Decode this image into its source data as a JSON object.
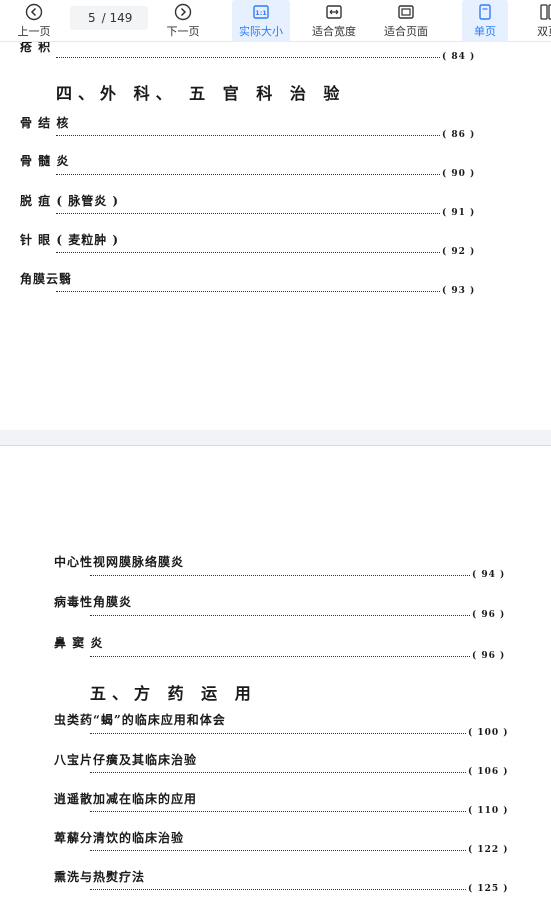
{
  "toolbar": {
    "prev_label": "上一页",
    "page_current": "5",
    "page_total": "/ 149",
    "next_label": "下一页",
    "actual_size_label": "实际大小",
    "fit_width_label": "适合宽度",
    "fit_page_label": "适合页面",
    "single_page_label": "单页",
    "double_page_label": "双页"
  },
  "page1": {
    "partial_top": "疮  积",
    "partial_top_page": "( 84 )",
    "heading": "四、外 科、 五 官 科 治 验",
    "entries": [
      {
        "title": "骨  结  核",
        "page": "( 86 )"
      },
      {
        "title": "骨  髓  炎",
        "page": "( 90 )"
      },
      {
        "title": "脱     疽 ( 脉管炎 )",
        "page": "( 91 )"
      },
      {
        "title": "针     眼 ( 麦粒肿 )",
        "page": "( 92 )"
      },
      {
        "title": "角膜云翳",
        "page": "( 93 )"
      }
    ]
  },
  "page2": {
    "entries_a": [
      {
        "title": "中心性视网膜脉络膜炎",
        "page": "( 94 )"
      },
      {
        "title": "病毒性角膜炎",
        "page": "( 96 )"
      },
      {
        "title": "鼻  窦  炎",
        "page": "( 96 )"
      }
    ],
    "heading": "五、方  药  运  用",
    "entries_b": [
      {
        "title": "虫类药“蝎”的临床应用和体会",
        "page": "( 100 )"
      },
      {
        "title": "八宝片仔癀及其临床治验",
        "page": "( 106 )"
      },
      {
        "title": "逍遥散加减在临床的应用",
        "page": "( 110 )"
      },
      {
        "title": "萆薢分清饮的临床治验",
        "page": "( 122 )"
      },
      {
        "title": "熏洗与热熨疗法",
        "page": "( 125 )"
      }
    ]
  }
}
